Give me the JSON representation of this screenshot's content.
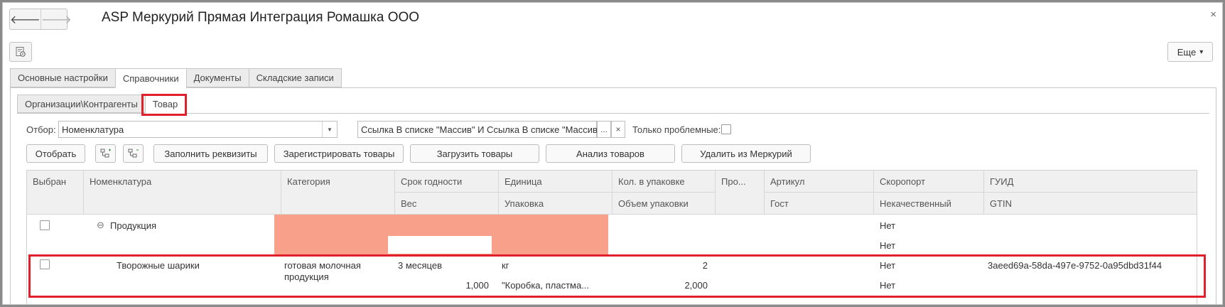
{
  "window": {
    "title": "ASP Меркурий Прямая Интеграция Ромашка ООО",
    "back_glyph": "🡐",
    "forward_glyph": "🡒",
    "close_glyph": "×",
    "more_label": "Еще",
    "more_arrow": "▾",
    "icons": [
      "arrow-left-icon",
      "arrow-right-icon",
      "close-icon",
      "settings-icon",
      "chevron-down-icon"
    ]
  },
  "tabs": [
    {
      "label": "Основные настройки",
      "active": false
    },
    {
      "label": "Справочники",
      "active": true
    },
    {
      "label": "Документы",
      "active": false
    },
    {
      "label": "Складские записи",
      "active": false
    }
  ],
  "subtabs": [
    {
      "label": "Организации\\Контрагенты",
      "active": false
    },
    {
      "label": "Товар",
      "active": true
    }
  ],
  "filter": {
    "label": "Отбор:",
    "field_value": "Номенклатура",
    "condition_value": "Ссылка В списке \"Массив\" И Ссылка В списке \"Массив\"",
    "select_glyph": "...",
    "clear_glyph": "×",
    "dropdown_glyph": "▼",
    "problem_only_label": "Только проблемные:",
    "problem_only_checked": false
  },
  "toolbar": {
    "select_label": "Отобрать",
    "fill_label": "Заполнить реквизиты",
    "register_label": "Зарегистрировать товары",
    "load_label": "Загрузить товары",
    "analyze_label": "Анализ товаров",
    "delete_label": "Удалить из Меркурий"
  },
  "table": {
    "headers_top": [
      "Выбран",
      "Номенклатура",
      "Категория",
      "Срок годности",
      "Единица",
      "Кол. в упаковке",
      "Про...",
      "Артикул",
      "Скоропорт",
      "ГУИД"
    ],
    "headers_bottom": [
      "",
      "",
      "",
      "Вес",
      "Упаковка",
      "Объем упаковки",
      "",
      "Гост",
      "Некачественный",
      "GTIN"
    ],
    "group_row": {
      "expand_glyph": "⊖",
      "name": "Продукция",
      "perishable": "Нет",
      "defective": "Нет"
    },
    "item_row": {
      "name": "Творожные шарики",
      "category_line1": "готовая молочная",
      "category_line2": "продукция",
      "shelf_life": "3 месяцев",
      "weight": "1,000",
      "unit": "кг",
      "package": "\"Коробка, пластма...",
      "qty_per_pack": "2",
      "pack_volume": "2,000",
      "perishable": "Нет",
      "defective": "Нет",
      "guid": "3aeed69a-58da-497e-9752-0a95dbd31f44"
    }
  }
}
